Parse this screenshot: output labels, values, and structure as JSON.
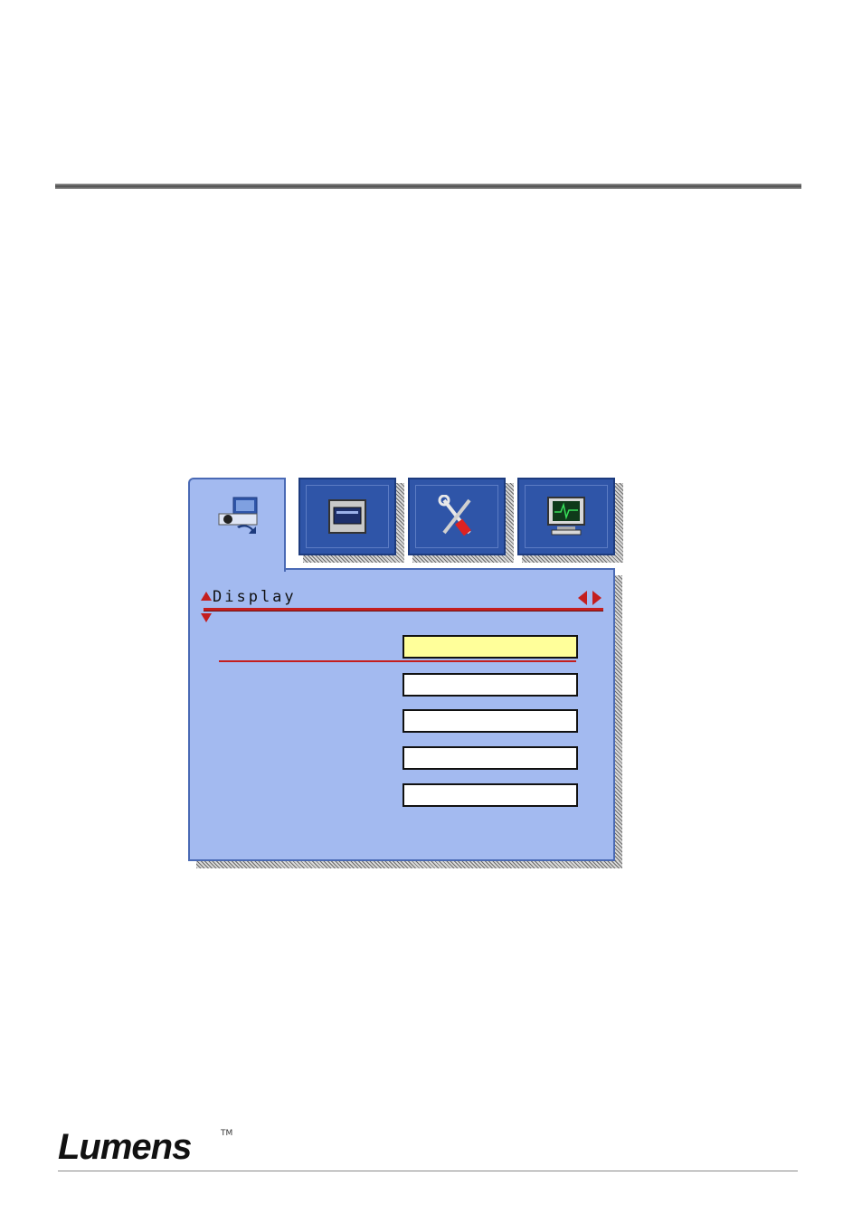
{
  "osd_menu": {
    "title": "Display",
    "tabs": [
      {
        "icon": "projector-camera-icon",
        "active": true
      },
      {
        "icon": "display-panel-icon",
        "active": false
      },
      {
        "icon": "tools-icon",
        "active": false
      },
      {
        "icon": "monitor-waveform-icon",
        "active": false
      }
    ],
    "items": [
      {
        "label": "",
        "value": "",
        "selected": true
      },
      {
        "label": "",
        "value": "",
        "selected": false
      },
      {
        "label": "",
        "value": "",
        "selected": false
      },
      {
        "label": "",
        "value": "",
        "selected": false
      },
      {
        "label": "",
        "value": "",
        "selected": false
      }
    ],
    "colors": {
      "panel": "#a3baf0",
      "tab": "#2f55a8",
      "accent": "#c41e1e",
      "selected_fill": "#ffff9a"
    }
  },
  "footer": {
    "logo_text": "Lumens",
    "logo_tm": "TM"
  }
}
